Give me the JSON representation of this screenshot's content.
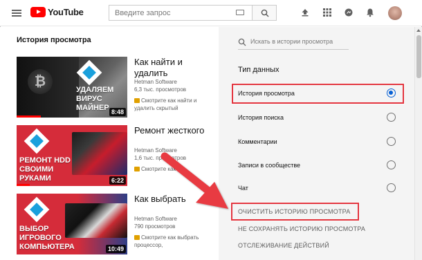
{
  "header": {
    "brand": "YouTube",
    "search_placeholder": "Введите запрос",
    "icons": [
      "menu-icon",
      "keyboard-icon",
      "search-icon",
      "upload-icon",
      "apps-icon",
      "messages-icon",
      "notifications-icon",
      "avatar"
    ]
  },
  "history": {
    "title": "История просмотра",
    "videos": [
      {
        "title": "Как найти и удалить",
        "channel": "Hetman Software",
        "views": "6,3 тыс. просмотров",
        "note": "Смотрите как найти и удалить скрытый",
        "thumb_text": "УДАЛЯЕМ ВИРУС МАЙНЕР",
        "duration": "8:48",
        "watched_fraction": 0.22
      },
      {
        "title": "Ремонт жесткого",
        "channel": "Hetman Software",
        "views": "1,6 тыс. просмотров",
        "note": "Смотрите как",
        "thumb_text": "РЕМОНТ HDD СВОИМИ РУКАМИ",
        "duration": "6:22",
        "watched_fraction": 0.12
      },
      {
        "title": "Как выбрать",
        "channel": "Hetman Software",
        "views": "790 просмотров",
        "note": "Смотрите как выбрать процессор,",
        "thumb_text": "ВЫБОР ИГРОВОГО КОМПЬЮТЕРА",
        "duration": "10:49",
        "watched_fraction": 0.0
      }
    ]
  },
  "sidebar": {
    "search_placeholder": "Искать в истории просмотра",
    "type_title": "Тип данных",
    "options": [
      {
        "label": "История просмотра",
        "selected": true
      },
      {
        "label": "История поиска",
        "selected": false
      },
      {
        "label": "Комментарии",
        "selected": false
      },
      {
        "label": "Записи в сообществе",
        "selected": false
      },
      {
        "label": "Чат",
        "selected": false
      }
    ],
    "actions": [
      "ОЧИСТИТЬ ИСТОРИЮ ПРОСМОТРА",
      "НЕ СОХРАНЯТЬ ИСТОРИЮ ПРОСМОТРА",
      "ОТСЛЕЖИВАНИЕ ДЕЙСТВИЙ"
    ]
  },
  "colors": {
    "brand_red": "#ff0000",
    "highlight_red": "#e3343e",
    "radio_blue": "#065fd4",
    "sidebar_bg": "#f4f4f4"
  }
}
